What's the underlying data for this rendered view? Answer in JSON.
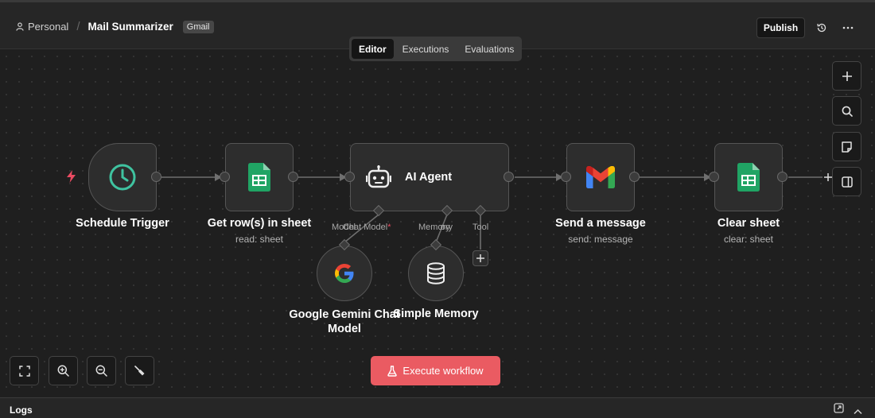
{
  "header": {
    "breadcrumb_project": "Personal",
    "breadcrumb_separator": "/",
    "workflow_title": "Mail Summarizer",
    "tag": "Gmail",
    "publish_label": "Publish",
    "history_icon": "history-icon",
    "more_icon": "ellipsis-icon"
  },
  "tabs": [
    {
      "label": "Editor",
      "active": true
    },
    {
      "label": "Executions",
      "active": false
    },
    {
      "label": "Evaluations",
      "active": false
    }
  ],
  "nodes": {
    "schedule": {
      "title": "Schedule Trigger",
      "icon": "clock-icon"
    },
    "get_rows": {
      "title": "Get row(s) in sheet",
      "subtitle": "read: sheet",
      "icon": "google-sheets-icon"
    },
    "agent": {
      "title": "AI Agent",
      "icon": "robot-icon"
    },
    "send": {
      "title": "Send a message",
      "subtitle": "send: message",
      "icon": "gmail-icon"
    },
    "clear": {
      "title": "Clear sheet",
      "subtitle": "clear: sheet",
      "icon": "google-sheets-icon"
    },
    "gemini": {
      "title_line1": "Google Gemini Chat",
      "title_line2": "Model",
      "icon": "google-icon"
    },
    "memory": {
      "title": "Simple Memory",
      "icon": "database-icon"
    }
  },
  "agent_ports": {
    "chat_model": "Chat Model",
    "chat_model_required": "*",
    "model_overlap": "Model",
    "memory": "Memory",
    "memory_overlap": "ory",
    "tool": "Tool"
  },
  "canvas_controls": {
    "zoom_in_side": "plus-icon",
    "search": "search-icon",
    "sticky_note": "note-icon",
    "panel": "panel-icon",
    "fit": "fit-view-icon",
    "zoom_in": "zoom-in-icon",
    "zoom_out": "zoom-out-icon",
    "clean": "broom-icon"
  },
  "execute_label": "Execute workflow",
  "logs_label": "Logs",
  "colors": {
    "accent": "#ea5b62",
    "trigger_bolt": "#ea4b62",
    "clock": "#3fc3a0",
    "sheets": "#20a464"
  }
}
